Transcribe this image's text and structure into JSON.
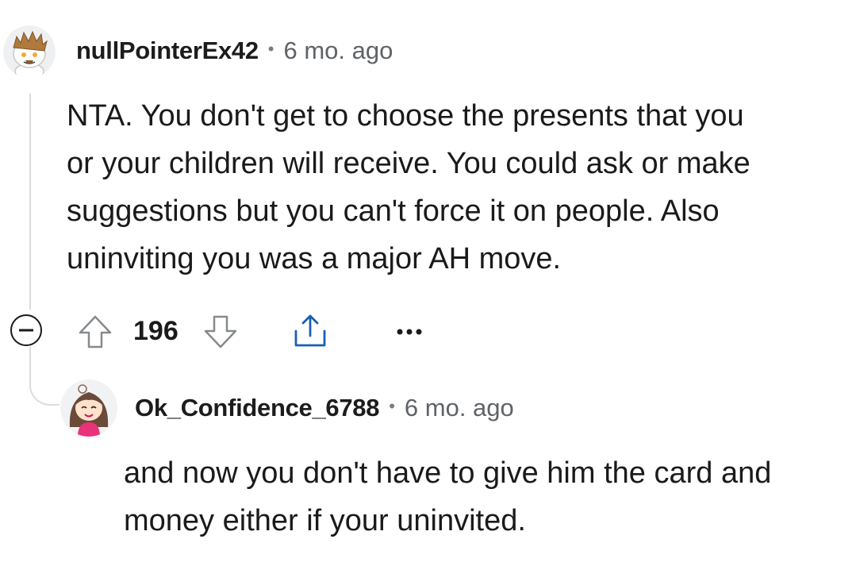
{
  "comments": [
    {
      "username": "nullPointerEx42",
      "separator": "•",
      "timestamp": "6 mo. ago",
      "body_lines": [
        "NTA. You don't get to choose the presents that you",
        "or your children will receive. You could ask or make",
        "suggestions but you can't force it on people. Also",
        "uninviting you was a major AH move."
      ],
      "score": "196",
      "avatar_icon": "snoo-avatar-icon",
      "actions": [
        "collapse-icon",
        "upvote-icon",
        "downvote-icon",
        "share-icon",
        "more-options-icon"
      ]
    },
    {
      "username": "Ok_Confidence_6788",
      "separator": "•",
      "timestamp": "6 mo. ago",
      "body_lines": [
        "and now you don't have to give him the card and",
        "money either if your uninvited."
      ],
      "avatar_icon": "girl-avatar-icon"
    }
  ],
  "colors": {
    "text": "#1a1a1b",
    "meta": "#5f6368",
    "thread_line": "#dadcde",
    "icon_gray": "#878a8c"
  }
}
